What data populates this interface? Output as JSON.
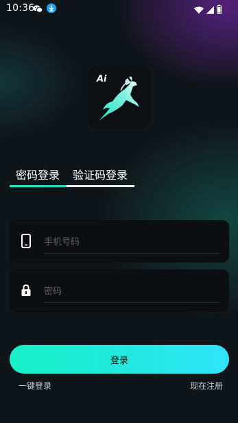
{
  "status_bar": {
    "time": "10:36",
    "left_icons": [
      "wechat-icon",
      "download-icon"
    ],
    "right_icons": [
      "wifi-icon",
      "signal-icon",
      "battery-icon"
    ]
  },
  "logo": {
    "text": "Ai",
    "icon": "deer-logo-icon"
  },
  "tabs": [
    {
      "label": "密码登录",
      "active": true
    },
    {
      "label": "验证码登录",
      "active": false
    }
  ],
  "form": {
    "phone_placeholder": "手机号码",
    "phone_icon": "phone-icon",
    "password_placeholder": "密码",
    "password_icon": "lock-icon"
  },
  "login_button": "登录",
  "links": {
    "one_click": "一键登录",
    "register": "现在注册"
  },
  "colors": {
    "accent_start": "#19f1c8",
    "accent_end": "#30e3f9",
    "background": "#101519"
  }
}
